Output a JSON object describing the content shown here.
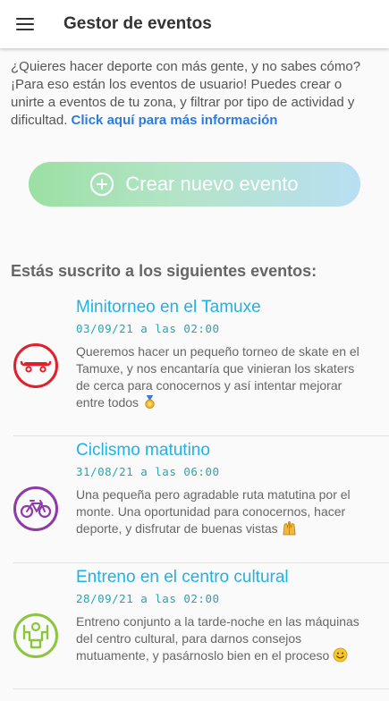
{
  "appbar": {
    "title": "Gestor de eventos",
    "menu_icon": "hamburger-menu-icon"
  },
  "intro": {
    "text": "¿Quieres hacer deporte con más gente, y no sabes cómo? ¡Para eso están los eventos de usuario! Puedes crear o unirte a eventos de tu zona, y filtrar por tipo de actividad y dificultad. ",
    "link_text": "Click aquí para más información"
  },
  "create_button": {
    "label": "Crear nuevo evento",
    "icon": "plus-circle-icon"
  },
  "section_title": "Estás suscrito a los siguientes eventos:",
  "events": [
    {
      "title": "Minitorneo en el Tamuxe",
      "date": "03/09/21 a las 02:00",
      "description": "Queremos hacer un pequeño torneo de skate en el Tamuxe, y nos encantaría que vinieran los skaters de cerca para conocernos y así intentar mejorar entre todos",
      "icon": "skateboard-icon",
      "color": "#e0202c",
      "emoji": "medal-emoji"
    },
    {
      "title": "Ciclismo matutino",
      "date": "31/08/21 a las 06:00",
      "description": "Una pequeña pero agradable ruta matutina por el monte. Una oportunidad para conocernos, hacer deporte, y disfrutar de buenas vistas",
      "icon": "bicycle-icon",
      "color": "#8e3aa8",
      "emoji": "raised-hands-emoji"
    },
    {
      "title": "Entreno en el centro cultural",
      "date": "28/09/21 a las 02:00",
      "description": "Entreno conjunto a la tarde-noche en las máquinas del centro cultural, para darnos consejos mutuamente, y pasárnoslo bien en el proceso",
      "icon": "weightlifting-icon",
      "color": "#8cc63f",
      "emoji": "smiling-face-emoji"
    }
  ]
}
